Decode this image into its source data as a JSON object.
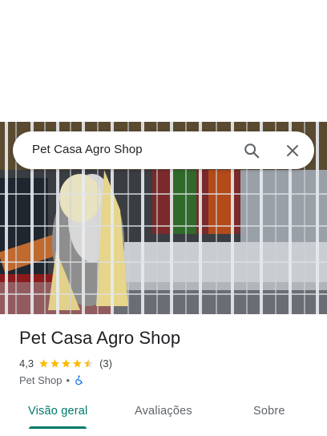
{
  "search": {
    "query": "Pet Casa Agro Shop"
  },
  "place": {
    "name": "Pet Casa Agro Shop",
    "rating": "4,3",
    "stars": 4.3,
    "review_count": "(3)",
    "category": "Pet Shop",
    "separator": "•"
  },
  "tabs": [
    {
      "label": "Visão geral",
      "active": true
    },
    {
      "label": "Avaliações",
      "active": false
    },
    {
      "label": "Sobre",
      "active": false
    }
  ],
  "colors": {
    "accent": "#00796b",
    "star": "#fbbc04",
    "accessibility": "#1a73e8"
  },
  "icons": {
    "search": "search-icon",
    "close": "close-icon",
    "accessibility": "wheelchair-icon"
  }
}
